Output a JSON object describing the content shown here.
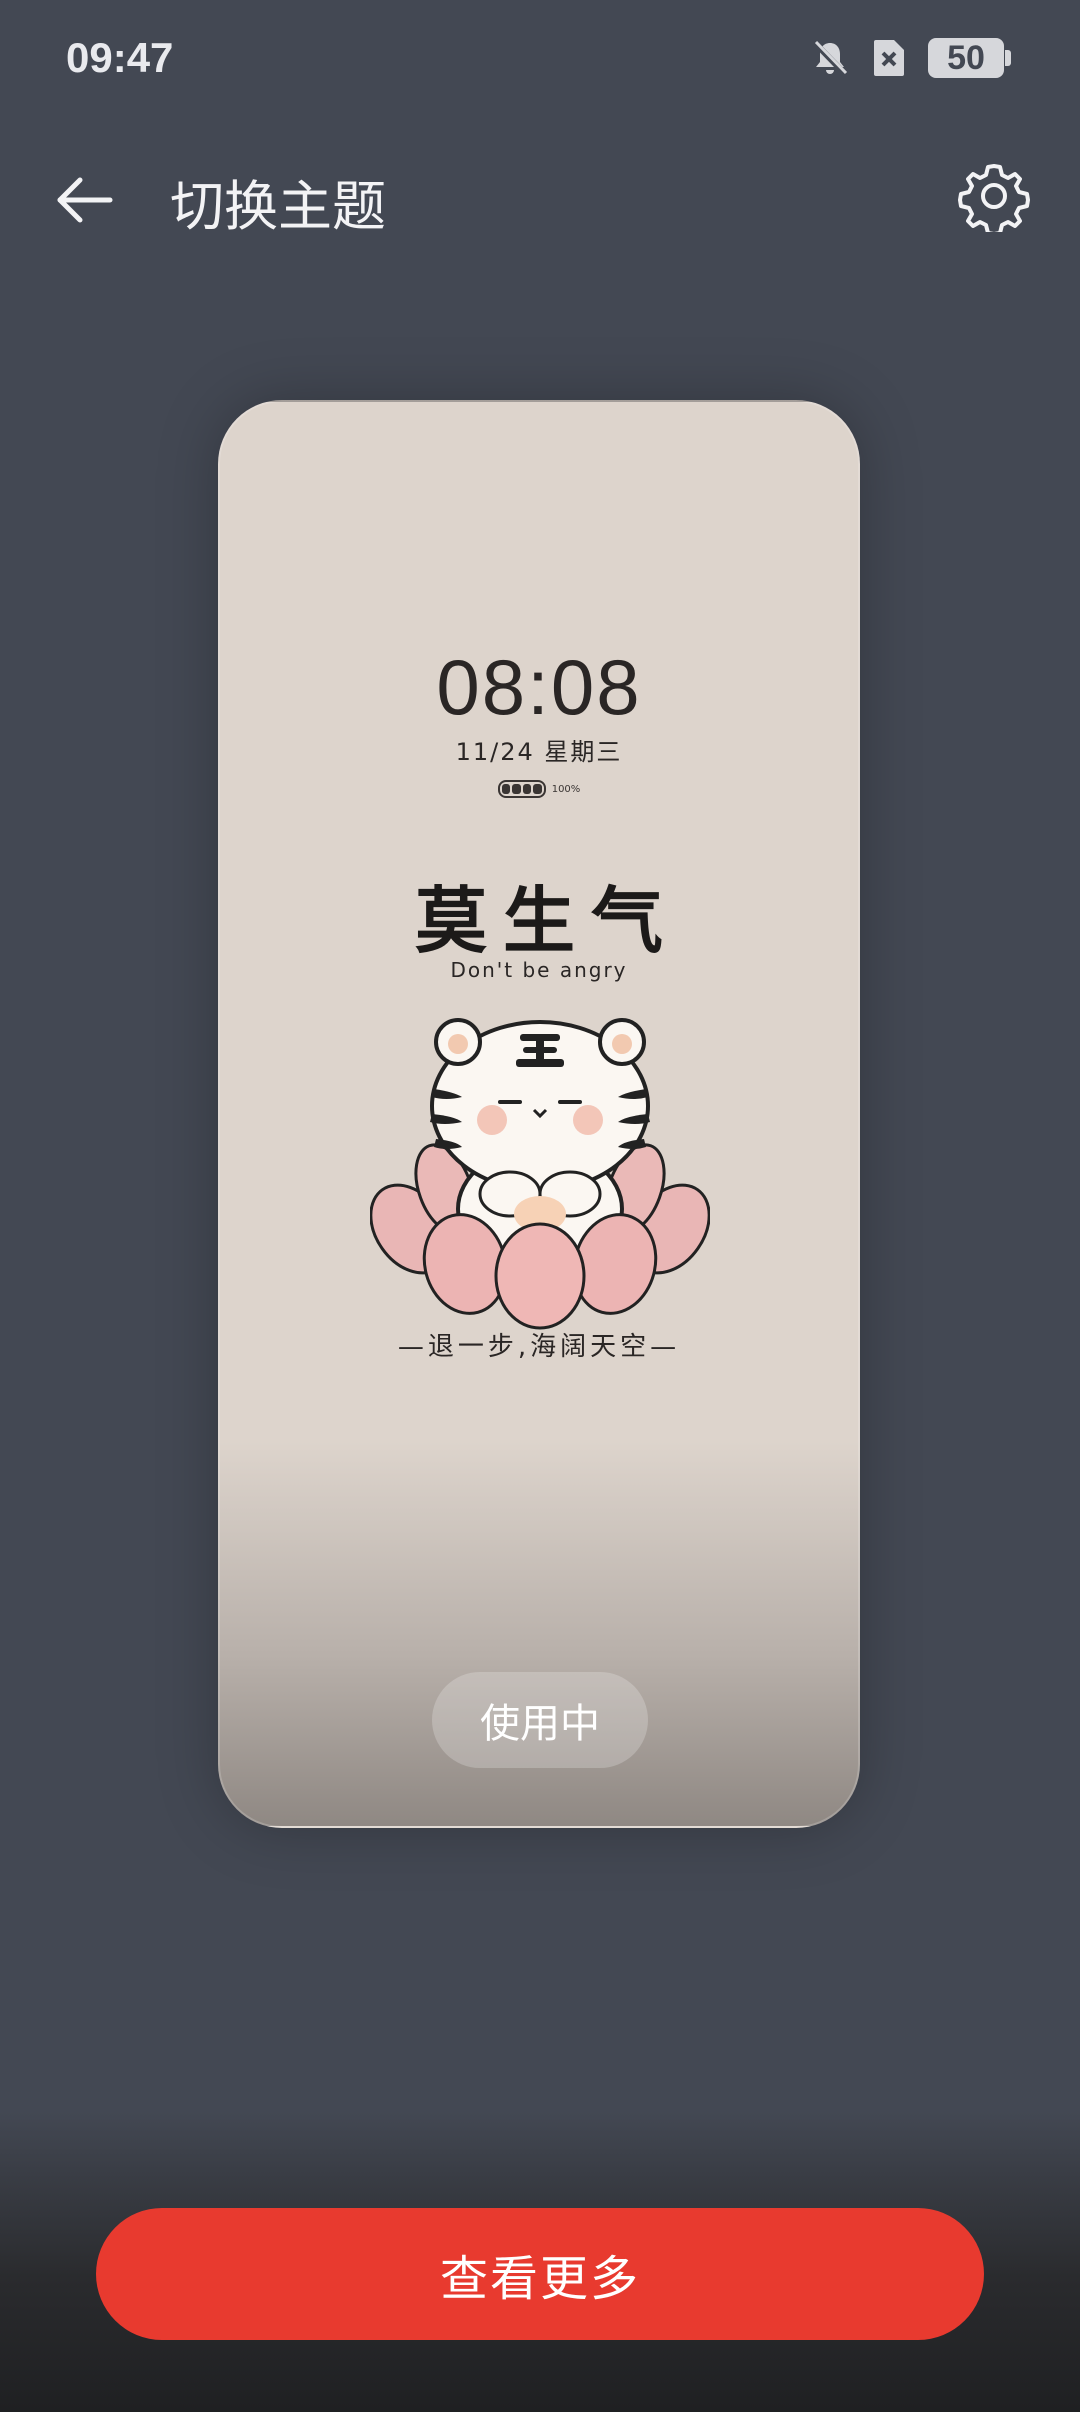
{
  "status_bar": {
    "time": "09:47",
    "battery_level": "50",
    "icons": [
      "bell-muted-icon",
      "sim-absent-icon",
      "battery-icon"
    ]
  },
  "header": {
    "title": "切换主题",
    "back_icon": "arrow-left-icon",
    "settings_icon": "gear-icon"
  },
  "preview": {
    "lock_time": "08:08",
    "lock_date": "11/24 星期三",
    "battery_percent": "100%",
    "slogan_cn": "莫生气",
    "slogan_en": "Don't be angry",
    "tagline": "—退一步,海阔天空—",
    "status_button": "使用中"
  },
  "actions": {
    "view_more": "查看更多"
  },
  "colors": {
    "background": "#434853",
    "card": "#ddd4cc",
    "accent": "#e83a2f"
  }
}
